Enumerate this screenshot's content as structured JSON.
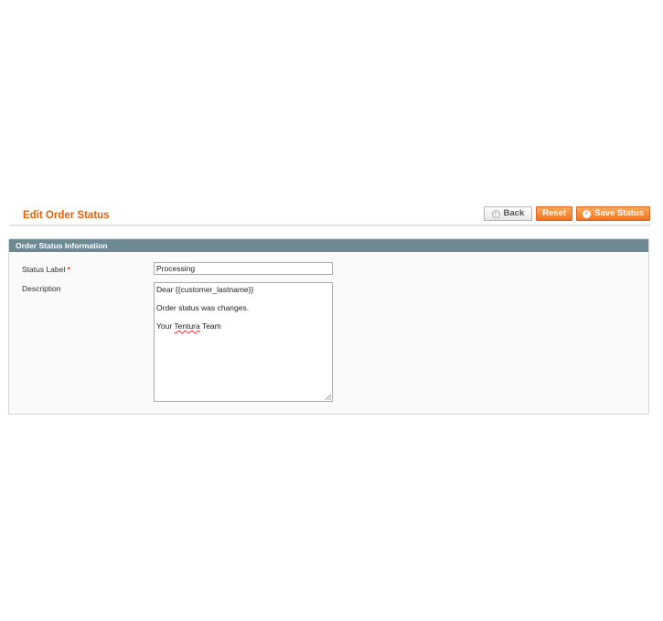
{
  "header": {
    "title": "Edit Order Status"
  },
  "toolbar": {
    "back_label": "Back",
    "reset_label": "Reset",
    "save_label": "Save Status",
    "accent_color": "#f07422"
  },
  "fieldset": {
    "title": "Order Status Information",
    "header_color": "#6f8992",
    "status_label": {
      "label": "Status Label",
      "required_mark": "*",
      "value": "Processing"
    },
    "description": {
      "label": "Description",
      "lines": [
        "Dear {{customer_lastname}}",
        "Order status was changes.",
        "Your ",
        "Tentura",
        " Team"
      ]
    }
  },
  "icons": {
    "back": "back-arrow-icon",
    "save": "checkmark-icon",
    "resize": "resize-grip-icon"
  }
}
